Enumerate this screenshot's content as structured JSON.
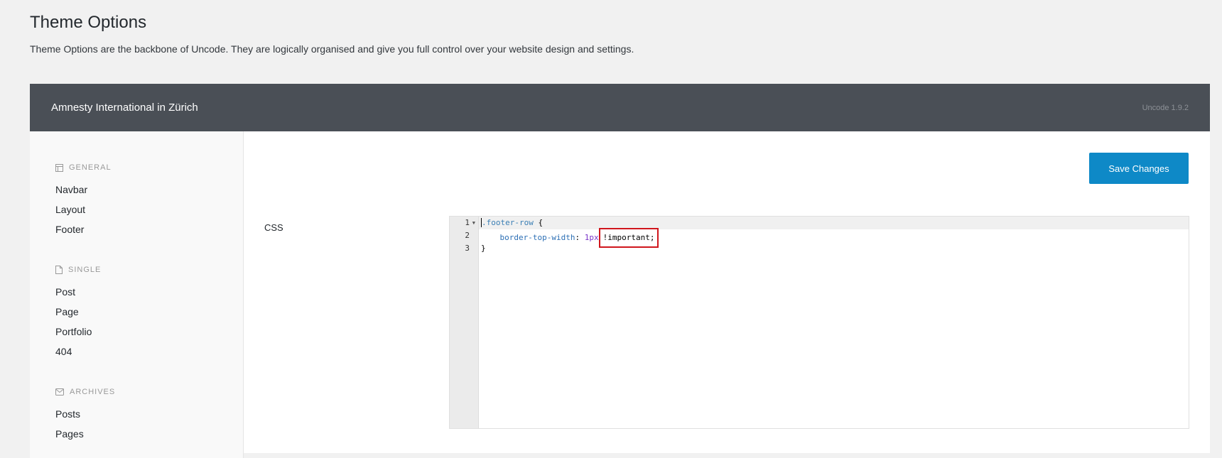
{
  "page": {
    "title": "Theme Options",
    "description": "Theme Options are the backbone of Uncode. They are logically organised and give you full control over your website design and settings."
  },
  "header": {
    "site_name": "Amnesty International in Zürich",
    "version": "Uncode 1.9.2"
  },
  "sidebar": {
    "groups": [
      {
        "heading": "GENERAL",
        "icon": "layout-icon",
        "items": [
          "Navbar",
          "Layout",
          "Footer"
        ]
      },
      {
        "heading": "SINGLE",
        "icon": "file-icon",
        "items": [
          "Post",
          "Page",
          "Portfolio",
          "404"
        ]
      },
      {
        "heading": "ARCHIVES",
        "icon": "inbox-icon",
        "items": [
          "Posts",
          "Pages"
        ]
      }
    ]
  },
  "main": {
    "save_label": "Save Changes",
    "css_label": "CSS",
    "editor": {
      "line_numbers": [
        "1",
        "2",
        "3"
      ],
      "line1_selector": ".footer-row",
      "line1_brace": " {",
      "line2_indent": "    ",
      "line2_property": "border-top-width",
      "line2_colon": ": ",
      "line2_value": "1px",
      "line2_important": "!important;",
      "line3": "}"
    }
  },
  "colors": {
    "header_bg": "#4a4f56",
    "save_button": "#0e89c7",
    "highlight_box": "#d0161d"
  }
}
